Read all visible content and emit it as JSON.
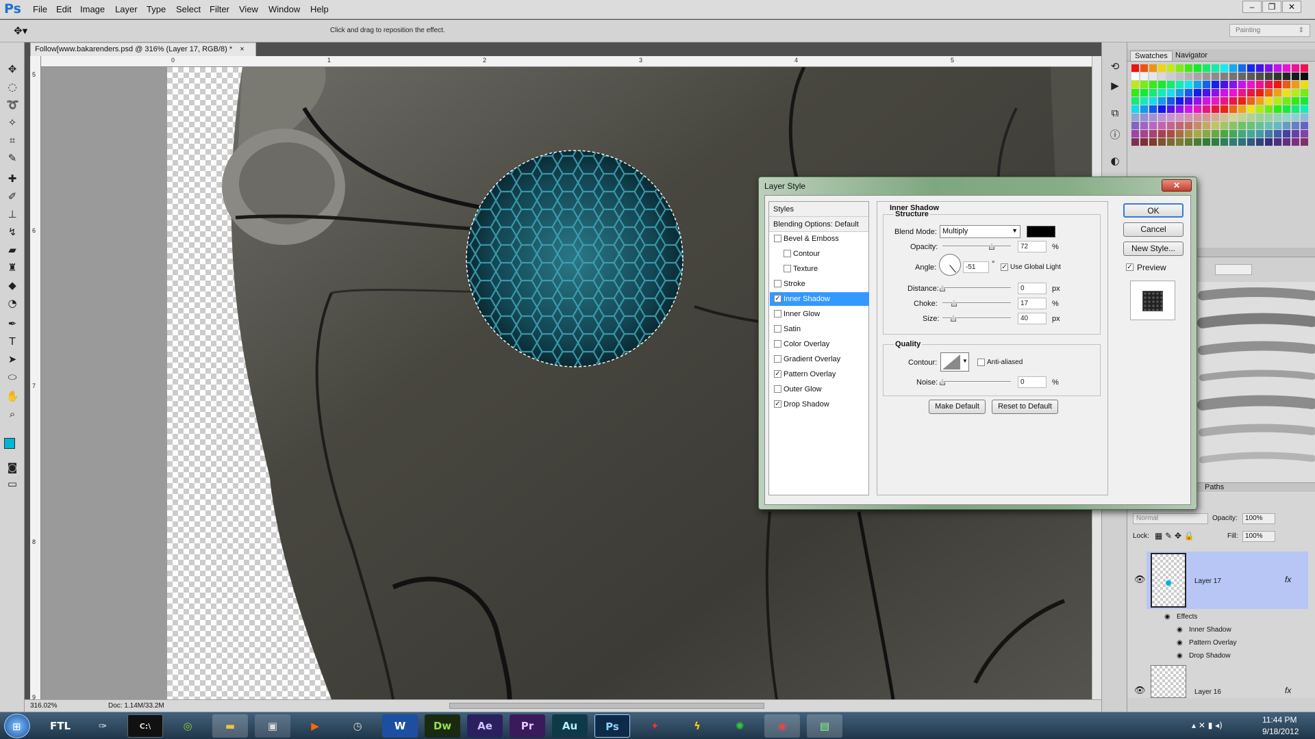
{
  "app": {
    "logo": "Ps"
  },
  "menubar": [
    "File",
    "Edit",
    "Image",
    "Layer",
    "Type",
    "Select",
    "Filter",
    "View",
    "Window",
    "Help"
  ],
  "window_buttons": [
    "–",
    "❐",
    "✕"
  ],
  "options_bar": {
    "hint": "Click and drag to reposition the effect.",
    "workspace": "Painting"
  },
  "document": {
    "tab_title": "Follow[www.bakarenders.psd @ 316% (Layer 17, RGB/8) *",
    "tab_close": "×",
    "ruler_top": [
      "0",
      "1",
      "2",
      "3",
      "4",
      "5"
    ],
    "ruler_left": [
      "5",
      "6",
      "7",
      "8",
      "9"
    ],
    "zoom": "316.02%",
    "doc_size": "Doc: 1.14M/33.2M"
  },
  "panels": {
    "tabs_top": [
      "Swatches",
      "Navigator"
    ],
    "paths_tab": "Paths",
    "layers": {
      "blend_mode": "Normal",
      "opacity_label": "Opacity:",
      "opacity_value": "100%",
      "lock_label": "Lock:",
      "fill_label": "Fill:",
      "fill_value": "100%",
      "rows": [
        {
          "name": "Layer 17",
          "fx": "fx",
          "selected": true
        },
        {
          "name": "Effects"
        },
        {
          "name": "Inner Shadow"
        },
        {
          "name": "Pattern Overlay"
        },
        {
          "name": "Drop Shadow"
        },
        {
          "name": "Layer 16",
          "fx": "fx"
        }
      ]
    }
  },
  "dialog": {
    "title": "Layer Style",
    "close": "✕",
    "styles_header": "Styles",
    "blending_options": "Blending Options: Default",
    "styles": [
      {
        "label": "Bevel & Emboss",
        "checked": false,
        "sub": false
      },
      {
        "label": "Contour",
        "checked": false,
        "sub": true
      },
      {
        "label": "Texture",
        "checked": false,
        "sub": true
      },
      {
        "label": "Stroke",
        "checked": false,
        "sub": false
      },
      {
        "label": "Inner Shadow",
        "checked": true,
        "sub": false,
        "selected": true
      },
      {
        "label": "Inner Glow",
        "checked": false,
        "sub": false
      },
      {
        "label": "Satin",
        "checked": false,
        "sub": false
      },
      {
        "label": "Color Overlay",
        "checked": false,
        "sub": false
      },
      {
        "label": "Gradient Overlay",
        "checked": false,
        "sub": false
      },
      {
        "label": "Pattern Overlay",
        "checked": true,
        "sub": false
      },
      {
        "label": "Outer Glow",
        "checked": false,
        "sub": false
      },
      {
        "label": "Drop Shadow",
        "checked": true,
        "sub": false
      }
    ],
    "section_title": "Inner Shadow",
    "structure_title": "Structure",
    "blend_mode_label": "Blend Mode:",
    "blend_mode_value": "Multiply",
    "shadow_color": "#000000",
    "opacity": {
      "label": "Opacity:",
      "value": "72",
      "unit": "%",
      "fraction": 0.72
    },
    "angle": {
      "label": "Angle:",
      "value": "-51",
      "unit": "°",
      "degrees": -51
    },
    "use_global_light": "Use Global Light",
    "distance": {
      "label": "Distance:",
      "value": "0",
      "unit": "px",
      "fraction": 0.0
    },
    "choke": {
      "label": "Choke:",
      "value": "17",
      "unit": "%",
      "fraction": 0.17
    },
    "size": {
      "label": "Size:",
      "value": "40",
      "unit": "px",
      "fraction": 0.16
    },
    "quality_title": "Quality",
    "contour_label": "Contour:",
    "anti_aliased": "Anti-aliased",
    "noise": {
      "label": "Noise:",
      "value": "0",
      "unit": "%",
      "fraction": 0.0
    },
    "make_default": "Make Default",
    "reset_default": "Reset to Default",
    "ok": "OK",
    "cancel": "Cancel",
    "new_style": "New Style...",
    "preview": "Preview"
  },
  "taskbar": {
    "apps": [
      "FTL",
      "",
      "",
      "",
      "",
      "",
      "",
      "",
      "W",
      "Dw",
      "Ae",
      "Pr",
      "Au",
      "Ps",
      "",
      "",
      "",
      "",
      ""
    ],
    "time": "11:44 PM",
    "date": "9/18/2012"
  },
  "colors": {
    "accent_blue": "#3399ff",
    "foreground_swatch": "#00b4d8"
  }
}
